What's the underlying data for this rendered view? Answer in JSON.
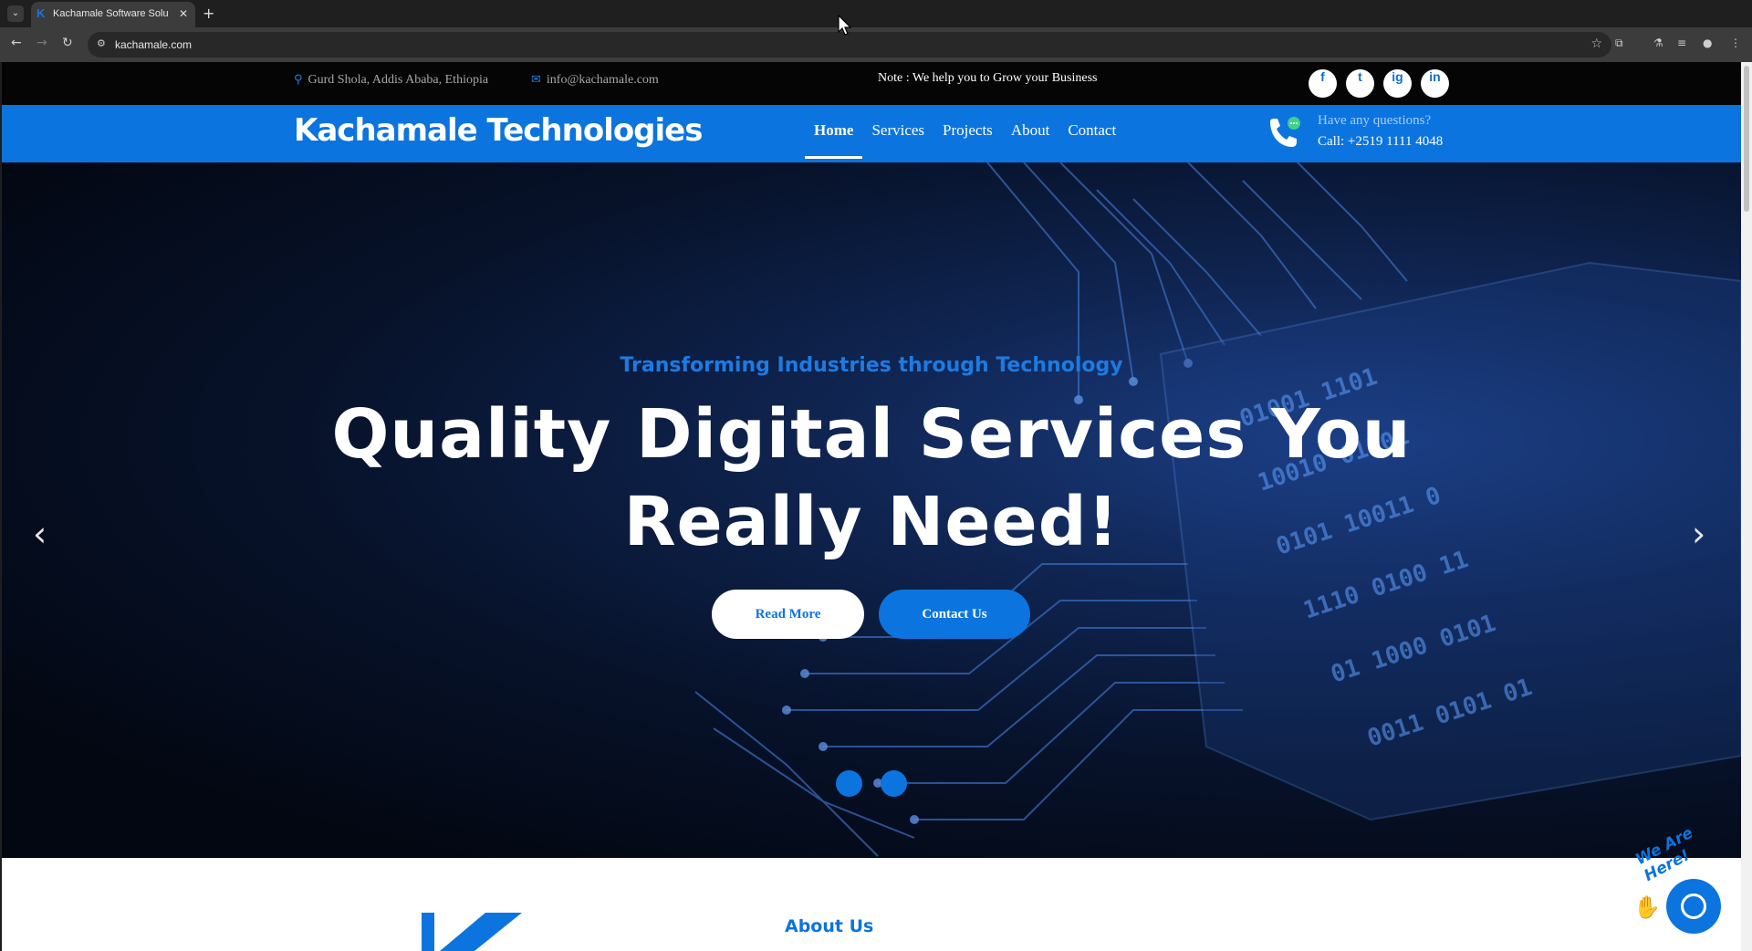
{
  "browser": {
    "tab_title": "Kachamale Software Solu",
    "tab_favicon": "K",
    "new_tab": "+",
    "url": "kachamale.com"
  },
  "topbar": {
    "location": "Gurd Shola, Addis Ababa, Ethiopia",
    "email": "info@kachamale.com",
    "note": "Note : We help you to Grow your Business",
    "socials": [
      "f",
      "t",
      "ig",
      "in"
    ]
  },
  "navbar": {
    "logo": "Kachamale Technologies",
    "menu": [
      {
        "label": "Home",
        "active": true
      },
      {
        "label": "Services",
        "active": false
      },
      {
        "label": "Projects",
        "active": false
      },
      {
        "label": "About",
        "active": false
      },
      {
        "label": "Contact",
        "active": false
      }
    ],
    "call_question": "Have any questions?",
    "call_number": "Call: +2519 1111 4048"
  },
  "hero": {
    "subtitle": "Transforming Industries through Technology",
    "title": "Quality Digital Services You Really Need!",
    "read_more": "Read More",
    "contact_us": "Contact Us",
    "slide_count": 2
  },
  "about": {
    "title": "About Us"
  },
  "chat": {
    "label": "We Are Here!"
  },
  "colors": {
    "brand": "#0b74df",
    "topbar": "#050505",
    "hero_accent": "#1c7be3"
  }
}
